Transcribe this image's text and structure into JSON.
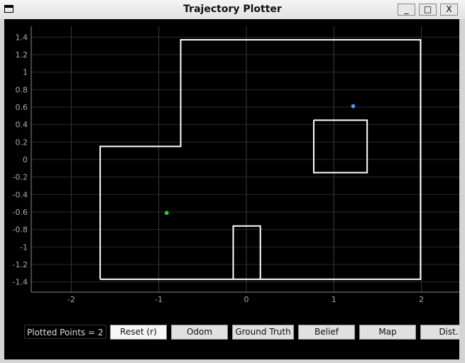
{
  "window": {
    "title": "Trajectory Plotter",
    "icon": "window-icon",
    "controls": {
      "minimize": "_",
      "maximize": "□",
      "close": "X"
    }
  },
  "chart_data": {
    "type": "scatter",
    "xlim": [
      -2.45,
      2.45
    ],
    "ylim": [
      -1.5,
      1.5
    ],
    "xticks": [
      "-2",
      "-1",
      "0",
      "1",
      "2"
    ],
    "xtick_values": [
      -2,
      -1,
      0,
      1,
      2
    ],
    "yticks": [
      "1.4",
      "1.2",
      "1",
      "0.8",
      "0.6",
      "0.4",
      "0.2",
      "0",
      "-0.2",
      "-0.4",
      "-0.6",
      "-0.8",
      "-1",
      "-1.2",
      "-1.4"
    ],
    "ytick_values": [
      1.4,
      1.2,
      1,
      0.8,
      0.6,
      0.4,
      0.2,
      0,
      -0.2,
      -0.4,
      -0.6,
      -0.8,
      -1,
      -1.2,
      -1.4
    ],
    "grid": true,
    "background": "#000000",
    "map_lines": [
      {
        "points": [
          [
            -1.67,
            -1.37
          ],
          [
            -1.67,
            0.15
          ],
          [
            -0.75,
            0.15
          ],
          [
            -0.75,
            1.37
          ],
          [
            1.99,
            1.37
          ],
          [
            1.99,
            -1.37
          ],
          [
            -1.67,
            -1.37
          ]
        ]
      },
      {
        "points": [
          [
            0.77,
            0.45
          ],
          [
            1.38,
            0.45
          ],
          [
            1.38,
            -0.15
          ],
          [
            0.77,
            -0.15
          ],
          [
            0.77,
            0.45
          ]
        ]
      },
      {
        "points": [
          [
            -0.15,
            -1.37
          ],
          [
            -0.15,
            -0.76
          ],
          [
            0.16,
            -0.76
          ],
          [
            0.16,
            -1.37
          ]
        ]
      }
    ],
    "points": [
      {
        "x": -0.91,
        "y": -0.61,
        "color": "#22dd22"
      },
      {
        "x": 1.22,
        "y": 0.61,
        "color": "#5599ee"
      }
    ]
  },
  "controls": {
    "status": "Plotted Points = 2",
    "buttons": [
      "Reset (r)",
      "Odom",
      "Ground Truth",
      "Belief",
      "Map",
      "Dist."
    ]
  }
}
